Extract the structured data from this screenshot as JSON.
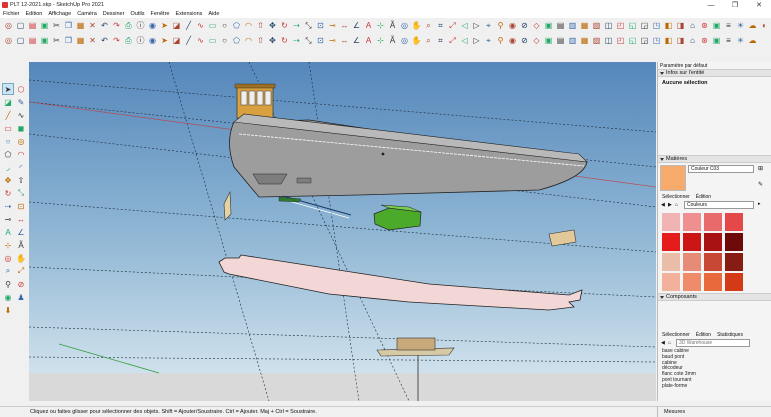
{
  "window": {
    "title": "PLT 12-2021.skp - SketchUp Pro 2021",
    "minimize": "—",
    "maximize": "❐",
    "close": "✕"
  },
  "menu": [
    "Fichier",
    "Edition",
    "Affichage",
    "Caméra",
    "Dessiner",
    "Outils",
    "Fenêtre",
    "Extensions",
    "Aide"
  ],
  "tray": {
    "title": "Paramètre par défaut",
    "entity_info": {
      "header": "Infos sur l'entité",
      "selection": "Aucune sélection"
    },
    "materials": {
      "header": "Matières",
      "current": "Couleur C03",
      "tabs": [
        "Sélectionner",
        "Édition"
      ],
      "library": "Couleurs",
      "swatches": [
        "#f1b4b4",
        "#f08f8f",
        "#e86a6a",
        "#e44848",
        "#e41c1c",
        "#cc1616",
        "#a81212",
        "#6e0a0a",
        "#eabda8",
        "#e68b76",
        "#c84836",
        "#861c14",
        "#f3b19b",
        "#ef8a6b",
        "#e86a3c",
        "#d53a18"
      ]
    },
    "components": {
      "header": "Composants",
      "tabs": [
        "Sélectionner",
        "Édition",
        "Statistiques"
      ],
      "search_placeholder": "3D Warehouse",
      "items": [
        "base cabine",
        "baud pont",
        "cabine",
        "décodeur",
        "flanc cote 3mm",
        "pont tournant",
        "plate-forme"
      ]
    }
  },
  "status": {
    "hint": "Cliquez ou faites glisser pour sélectionner des objets. Shift = Ajouter/Soustraire. Ctrl = Ajouter. Maj + Ctrl = Soustraire.",
    "measures_label": "Mesures"
  },
  "colors": {
    "sky_top": "#5a8fc0",
    "sky_bottom": "#c6dcea",
    "ground": "#d8d8d8",
    "hull": "#9b9b9b",
    "pink_plate": "#f3d7d7",
    "green_part": "#4caa2a",
    "accent_select": "#cce4f7"
  }
}
